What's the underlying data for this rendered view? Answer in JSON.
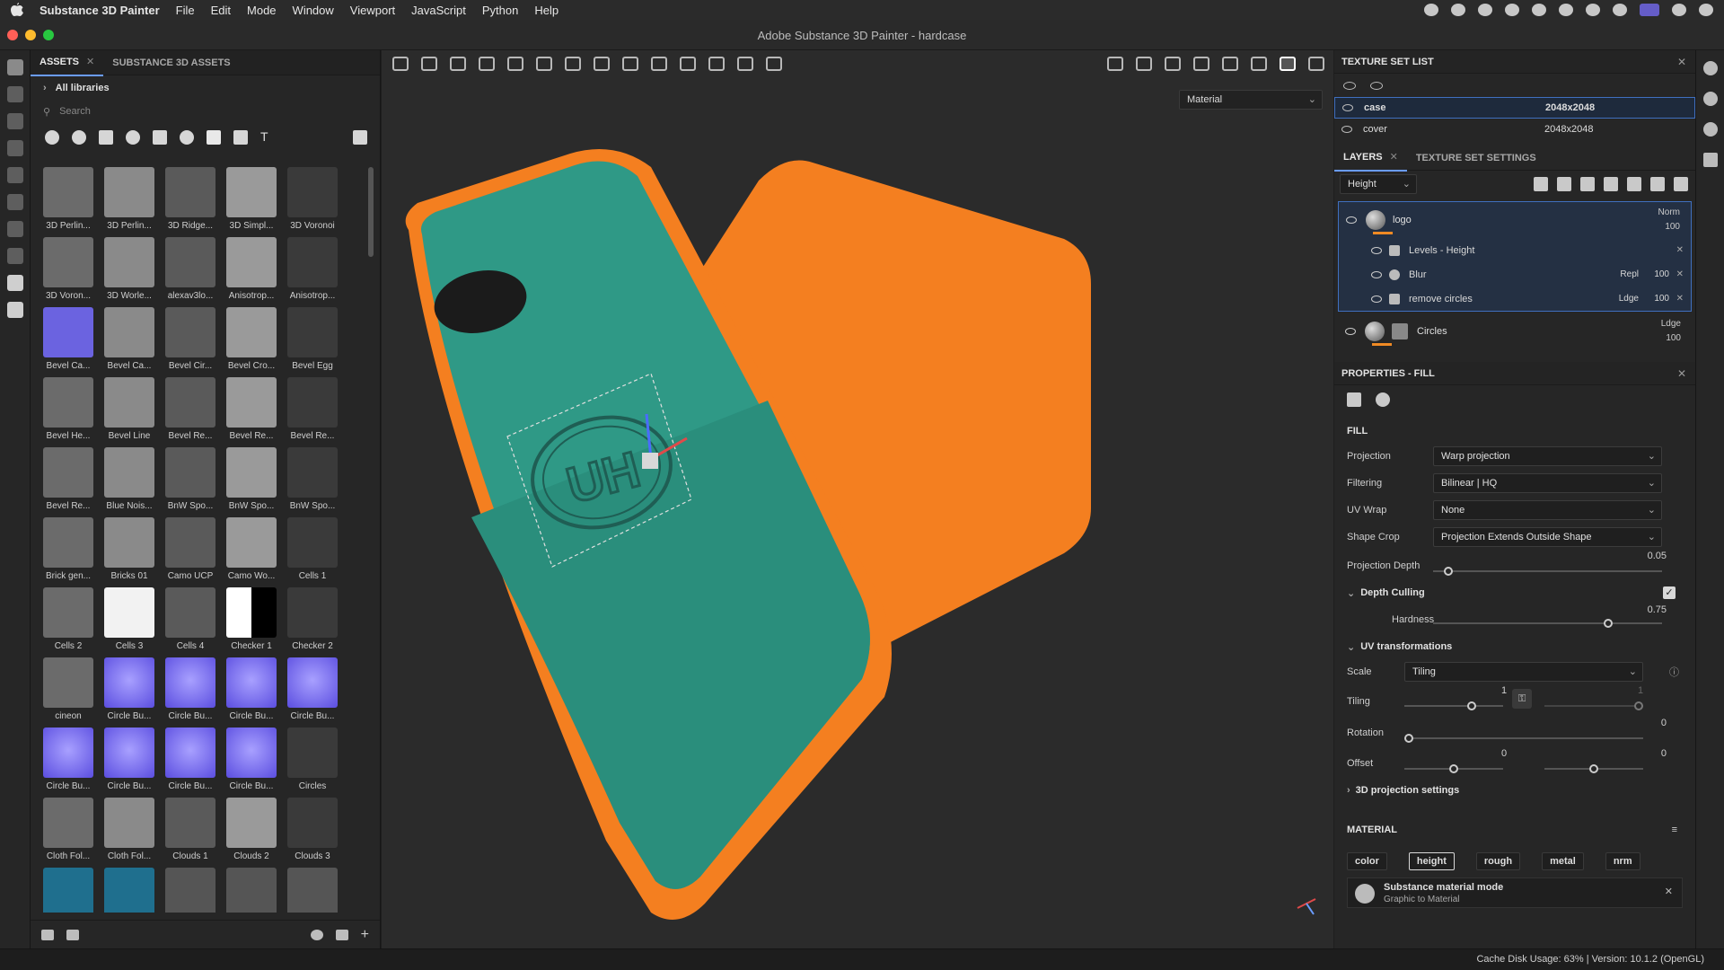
{
  "menubar": {
    "app": "Substance 3D Painter",
    "menus": [
      "File",
      "Edit",
      "Mode",
      "Window",
      "Viewport",
      "JavaScript",
      "Python",
      "Help"
    ]
  },
  "window": {
    "title": "Adobe Substance 3D Painter - hardcase"
  },
  "assets": {
    "tabs": [
      "ASSETS",
      "SUBSTANCE 3D ASSETS"
    ],
    "library": "All libraries",
    "search_placeholder": "Search",
    "items": [
      "3D Perlin...",
      "3D Perlin...",
      "3D Ridge...",
      "3D Simpl...",
      "3D Voronoi",
      "3D Voron...",
      "3D Worle...",
      "alexav3lo...",
      "Anisotrop...",
      "Anisotrop...",
      "Bevel Ca...",
      "Bevel Ca...",
      "Bevel Cir...",
      "Bevel Cro...",
      "Bevel Egg",
      "Bevel He...",
      "Bevel Line",
      "Bevel Re...",
      "Bevel Re...",
      "Bevel Re...",
      "Bevel Re...",
      "Blue Nois...",
      "BnW Spo...",
      "BnW Spo...",
      "BnW Spo...",
      "Brick gen...",
      "Bricks 01",
      "Camo UCP",
      "Camo Wo...",
      "Cells 1",
      "Cells 2",
      "Cells 3",
      "Cells 4",
      "Checker 1",
      "Checker 2",
      "cineon",
      "Circle Bu...",
      "Circle Bu...",
      "Circle Bu...",
      "Circle Bu...",
      "Circle Bu...",
      "Circle Bu...",
      "Circle Bu...",
      "Circle Bu...",
      "Circles",
      "Cloth Fol...",
      "Cloth Fol...",
      "Clouds 1",
      "Clouds 2",
      "Clouds 3",
      "",
      "",
      "",
      "",
      ""
    ]
  },
  "viewport": {
    "display_mode": "Material"
  },
  "texture_set_list": {
    "title": "TEXTURE SET LIST",
    "sets": [
      {
        "name": "case",
        "res": "2048x2048"
      },
      {
        "name": "cover",
        "res": "2048x2048"
      }
    ]
  },
  "layers": {
    "tabs": [
      "LAYERS",
      "TEXTURE SET SETTINGS"
    ],
    "channel": "Height",
    "logo": {
      "name": "logo",
      "blend": "Norm",
      "opacity": "100"
    },
    "effects": [
      {
        "name": "Levels - Height",
        "blend": "",
        "opacity": ""
      },
      {
        "name": "Blur",
        "blend": "Repl",
        "opacity": "100"
      },
      {
        "name": "remove circles",
        "blend": "Ldge",
        "opacity": "100"
      }
    ],
    "circles": {
      "name": "Circles",
      "blend": "Ldge",
      "opacity": "100"
    }
  },
  "properties": {
    "title": "PROPERTIES - FILL",
    "section": "FILL",
    "projection_label": "Projection",
    "projection": "Warp projection",
    "filtering_label": "Filtering",
    "filtering": "Bilinear | HQ",
    "uvwrap_label": "UV Wrap",
    "uvwrap": "None",
    "shapecrop_label": "Shape Crop",
    "shapecrop": "Projection Extends Outside Shape",
    "depth_label": "Projection Depth",
    "depth": "0.05",
    "culling_label": "Depth Culling",
    "hardness_label": "Hardness",
    "hardness": "0.75",
    "uvt_label": "UV transformations",
    "scale_label": "Scale",
    "scale": "Tiling",
    "tiling_label": "Tiling",
    "tiling": "1",
    "tiling2": "1",
    "rotation_label": "Rotation",
    "rotation": "0",
    "offset_label": "Offset",
    "offset_x": "0",
    "offset_y": "0",
    "proj3d_label": "3D projection settings",
    "material_label": "MATERIAL",
    "channels": [
      "color",
      "height",
      "rough",
      "metal",
      "nrm"
    ],
    "smm_title": "Substance material mode",
    "smm_sub": "Graphic to Material"
  },
  "status": {
    "text": "Cache Disk Usage:   63% | Version: 10.1.2 (OpenGL)"
  }
}
